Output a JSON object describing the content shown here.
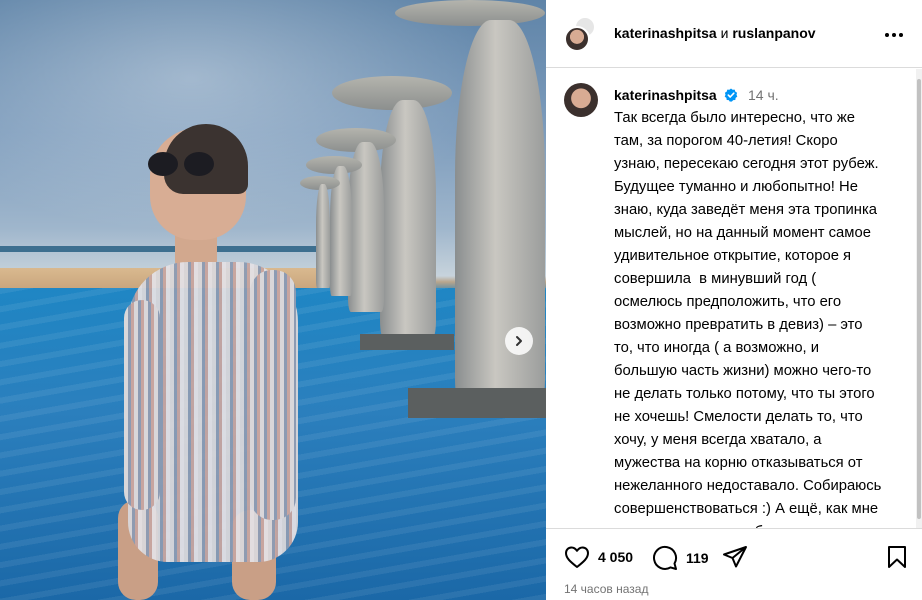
{
  "header": {
    "user1": "katerinashpitsa",
    "conjunction": "и",
    "user2": "ruslanpanov"
  },
  "post": {
    "username": "katerinashpitsa",
    "time": "14 ч.",
    "caption": "Так всегда было интересно, что же\nтам, за порогом 40-летия! Скоро\nузнаю, пересекаю сегодня этот рубеж.\nБудущее туманно и любопытно! Не\nзнаю, куда заведёт меня эта тропинка\nмыслей, но на данный момент самое\nудивительное открытие, которое я\nсовершила  в минувший год (\nосмелюсь предположить, что его\nвозможно превратить в девиз) – это\nто, что иногда ( а возможно, и\nбольшую часть жизни) можно чего-то\nне делать только потому, что ты этого\nне хочешь! Смелости делать то, что\nхочу, у меня всегда хватало, а\nмужества на корню отказываться от\nнежеланного недоставало. Собираюсь\nсовершенствоваться :) А ещё, как мне\nкажется, я подошла ближе к тому,\nчтобы всей душой понять, что такое –\nбыть благодарной за каждый"
  },
  "stats": {
    "likes": "4 050",
    "comments": "119"
  },
  "footer": {
    "timestamp": "14 часов назад"
  },
  "colors": {
    "verified": "#0095f6",
    "muted": "#737373",
    "divider": "#dbdbdb"
  },
  "icons": [
    "more-icon",
    "verified-icon",
    "heart-icon",
    "comment-icon",
    "share-icon",
    "bookmark-icon",
    "chevron-right-icon"
  ]
}
